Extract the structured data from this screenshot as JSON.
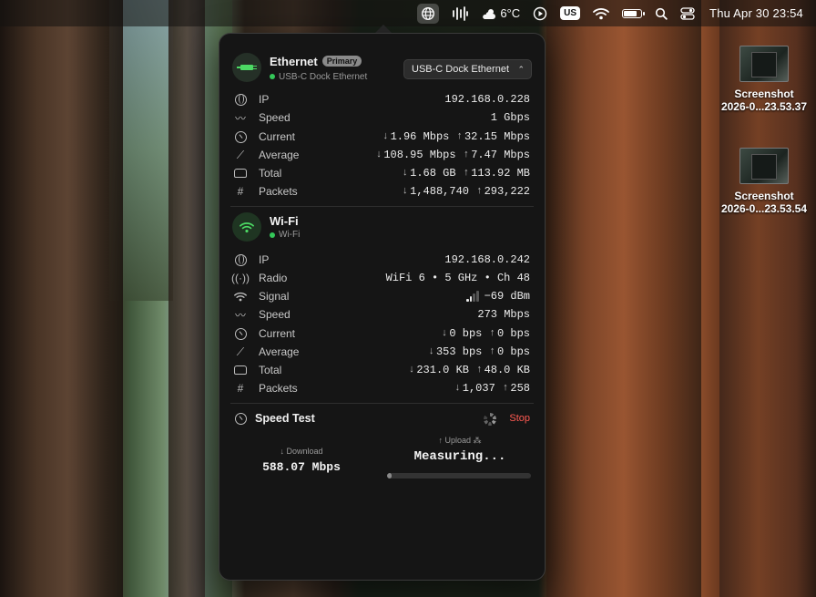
{
  "menubar": {
    "weather": "6°C",
    "keyboard": "US",
    "clock": "Thu Apr 30  23:54"
  },
  "desktop_files": [
    {
      "name1": "Screenshot",
      "name2": "2026-0...23.53.37"
    },
    {
      "name1": "Screenshot",
      "name2": "2026-0...23.53.54"
    }
  ],
  "ethernet": {
    "title": "Ethernet",
    "badge": "Primary",
    "subtitle": "USB-C Dock Ethernet",
    "dropdown": "USB-C Dock Ethernet",
    "rows": {
      "ip": {
        "label": "IP",
        "value": "192.168.0.228"
      },
      "speed": {
        "label": "Speed",
        "value": "1 Gbps"
      },
      "current": {
        "label": "Current",
        "down": "1.96 Mbps",
        "up": "32.15 Mbps"
      },
      "average": {
        "label": "Average",
        "down": "108.95 Mbps",
        "up": "7.47 Mbps"
      },
      "total": {
        "label": "Total",
        "down": "1.68 GB",
        "up": "113.92 MB"
      },
      "packets": {
        "label": "Packets",
        "down": "1,488,740",
        "up": "293,222"
      }
    }
  },
  "wifi": {
    "title": "Wi-Fi",
    "subtitle": "Wi-Fi",
    "rows": {
      "ip": {
        "label": "IP",
        "value": "192.168.0.242"
      },
      "radio": {
        "label": "Radio",
        "value": "WiFi 6 • 5 GHz • Ch 48"
      },
      "signal": {
        "label": "Signal",
        "value": "−69 dBm",
        "bars": 2,
        "bars_total": 4
      },
      "speed": {
        "label": "Speed",
        "value": "273 Mbps"
      },
      "current": {
        "label": "Current",
        "down": "0 bps",
        "up": "0 bps"
      },
      "average": {
        "label": "Average",
        "down": "353 bps",
        "up": "0 bps"
      },
      "total": {
        "label": "Total",
        "down": "231.0 KB",
        "up": "48.0 KB"
      },
      "packets": {
        "label": "Packets",
        "down": "1,037",
        "up": "258"
      }
    }
  },
  "speedtest": {
    "title": "Speed Test",
    "stop": "Stop",
    "download_label": "Download",
    "download_value": "588.07 Mbps",
    "upload_label": "Upload",
    "upload_value": "Measuring...",
    "upload_progress": 0.02
  },
  "colors": {
    "accent_green": "#34c759",
    "stop_red": "#ff5a52"
  }
}
